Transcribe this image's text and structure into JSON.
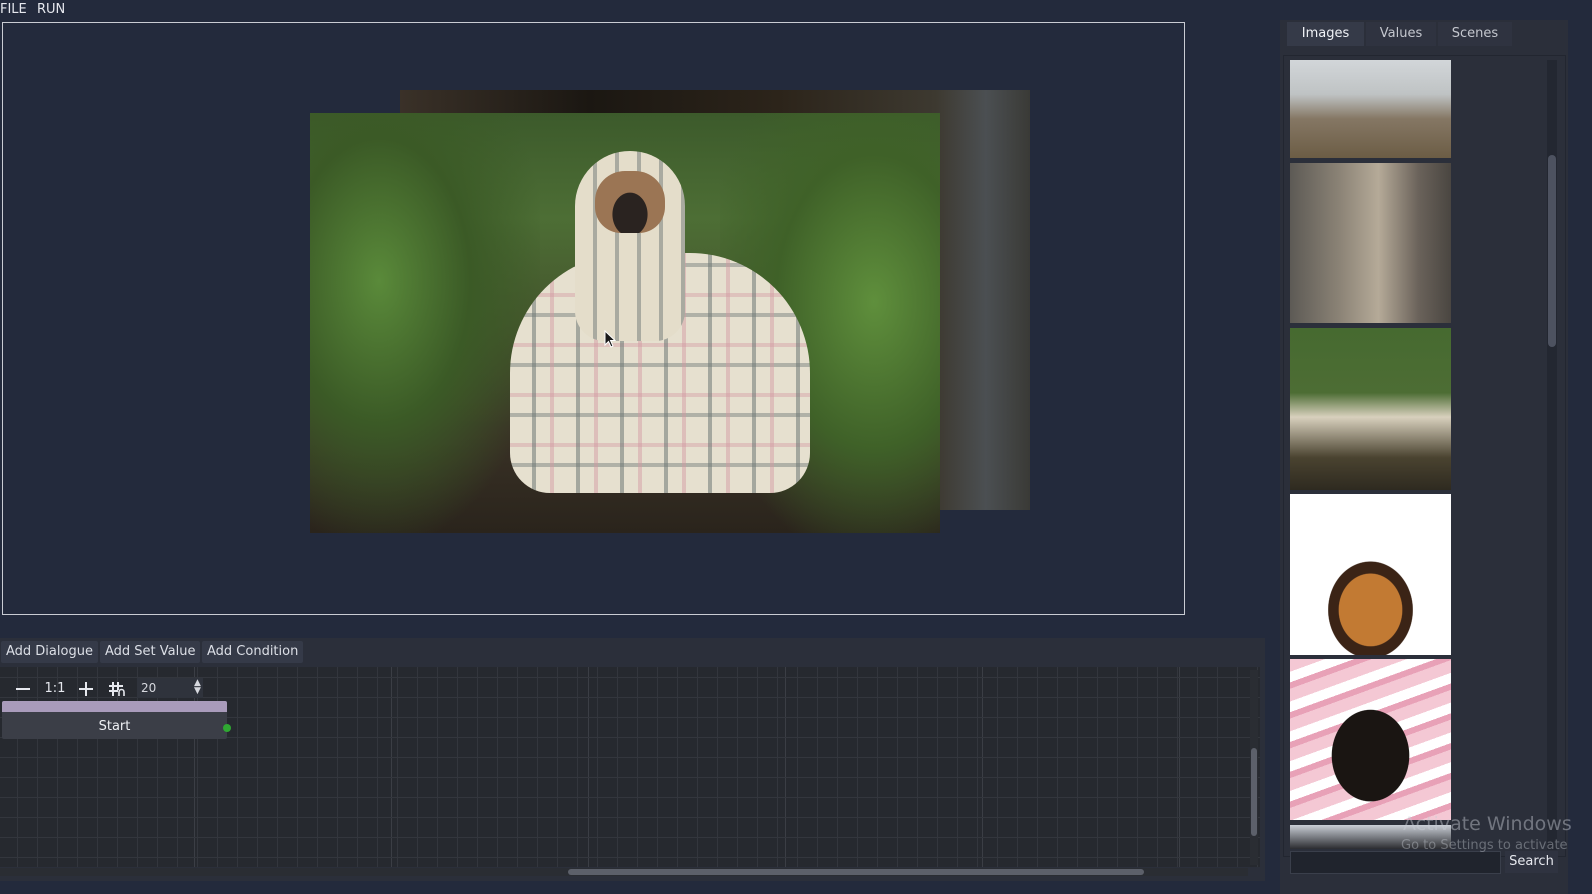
{
  "menu": {
    "items": [
      "FILE",
      "RUN"
    ]
  },
  "toolbar": {
    "add_dialogue": "Add Dialogue",
    "add_set_value": "Add Set Value",
    "add_condition": "Add Condition"
  },
  "graph": {
    "zoom_out_icon": "minus-icon",
    "zoom_reset_label": "1:1",
    "zoom_in_icon": "plus-icon",
    "snap_icon": "grid-snap-icon",
    "snap_value": "20",
    "start_node": {
      "label": "Start",
      "port_color": "#2fa832",
      "title_color": "#a99bbb"
    }
  },
  "right_panel": {
    "tabs": [
      "Images",
      "Values",
      "Scenes"
    ],
    "active_tab": "Images",
    "search": {
      "value": "",
      "button_label": "Search"
    }
  },
  "watermark": {
    "title": "Activate Windows",
    "subtitle": "Go to Settings to activate"
  },
  "colors": {
    "background": "#232a3c",
    "panel": "#2b2f3a",
    "accent": "#a99bbb"
  }
}
